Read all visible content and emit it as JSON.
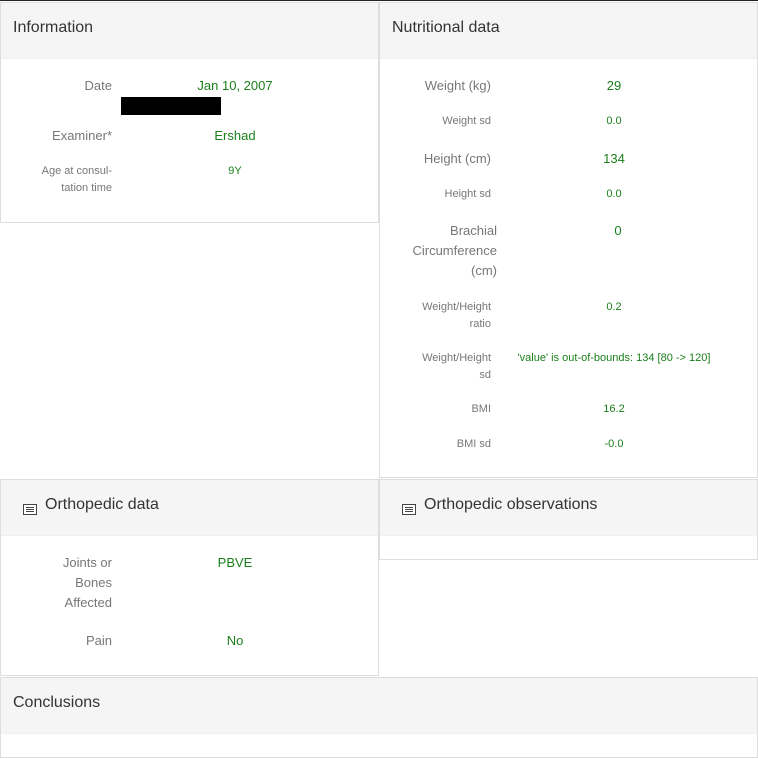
{
  "information": {
    "title": "Information",
    "date_label": "Date",
    "date_value": "Jan 10, 2007",
    "examiner_label": "Examiner*",
    "examiner_value": "Ershad",
    "age_label_line1": "Age at consul-",
    "age_label_line2": "tation time",
    "age_value": "9Y"
  },
  "nutritional": {
    "title": "Nutritional data",
    "weight_label": "Weight (kg)",
    "weight_value": "29",
    "weight_sd_label": "Weight sd",
    "weight_sd_value": "0.0",
    "height_label": "Height (cm)",
    "height_value": "134",
    "height_sd_label": "Height sd",
    "height_sd_value": "0.0",
    "brachial_label_1": "Brachial",
    "brachial_label_2": "Circumference",
    "brachial_label_3": "(cm)",
    "brachial_value": "0",
    "wh_ratio_label_1": "Weight/Height",
    "wh_ratio_label_2": "ratio",
    "wh_ratio_value": "0.2",
    "wh_sd_label_1": "Weight/Height",
    "wh_sd_label_2": "sd",
    "wh_sd_value": "'value' is out-of-bounds: 134 [80 -> 120]",
    "bmi_label": "BMI",
    "bmi_value": "16.2",
    "bmi_sd_label": "BMI sd",
    "bmi_sd_value": "-0.0"
  },
  "orthopedic": {
    "title": "Orthopedic data",
    "joints_label_1": "Joints or",
    "joints_label_2": "Bones",
    "joints_label_3": "Affected",
    "joints_value": "PBVE",
    "pain_label": "Pain",
    "pain_value": "No"
  },
  "observations": {
    "title": "Orthopedic observations"
  },
  "conclusions": {
    "title": "Conclusions"
  },
  "colors": {
    "value_green": "#1a7f1a",
    "label_gray": "#777777",
    "header_bg": "#f5f5f5"
  }
}
